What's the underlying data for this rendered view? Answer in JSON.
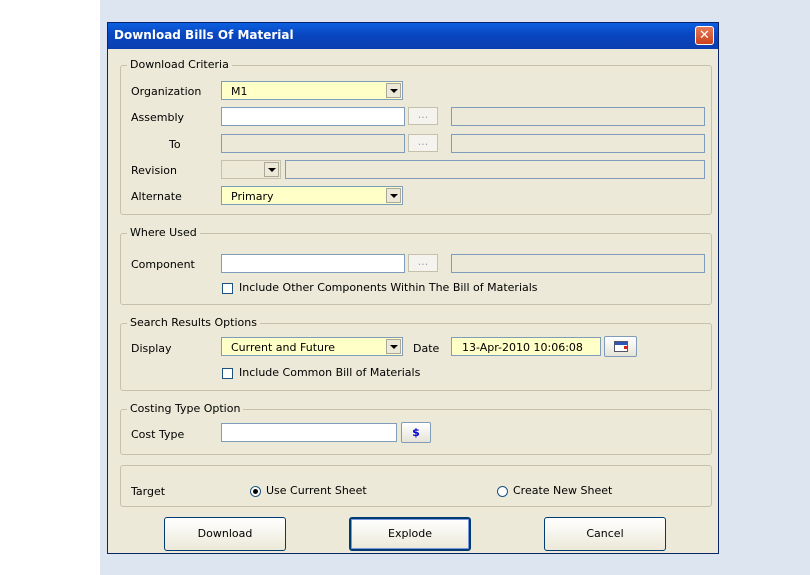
{
  "dialog": {
    "title": "Download Bills Of Material",
    "close_glyph": "✕"
  },
  "download_criteria": {
    "legend": "Download Criteria",
    "organization_label": "Organization",
    "organization_value": "M1",
    "assembly_label": "Assembly",
    "assembly_value": "",
    "to_label": "To",
    "revision_label": "Revision",
    "alternate_label": "Alternate",
    "alternate_value": "Primary",
    "ellipsis": "..."
  },
  "where_used": {
    "legend": "Where Used",
    "component_label": "Component",
    "include_other_label": "Include Other Components Within The Bill of Materials",
    "ellipsis": "..."
  },
  "search_results": {
    "legend": "Search Results Options",
    "display_label": "Display",
    "display_value": "Current and Future",
    "date_label": "Date",
    "date_value": "13-Apr-2010 10:06:08",
    "include_common_label": "Include Common Bill of Materials"
  },
  "costing": {
    "legend": "Costing Type Option",
    "cost_type_label": "Cost Type",
    "dollar_glyph": "$"
  },
  "target": {
    "label": "Target",
    "use_current_label": "Use Current Sheet",
    "create_new_label": "Create New Sheet",
    "selected": "Use Current Sheet"
  },
  "buttons": {
    "download": "Download",
    "explode": "Explode",
    "cancel": "Cancel"
  },
  "icons": [
    "close-icon",
    "dropdown-arrow-icon",
    "calendar-icon",
    "dollar-icon"
  ]
}
